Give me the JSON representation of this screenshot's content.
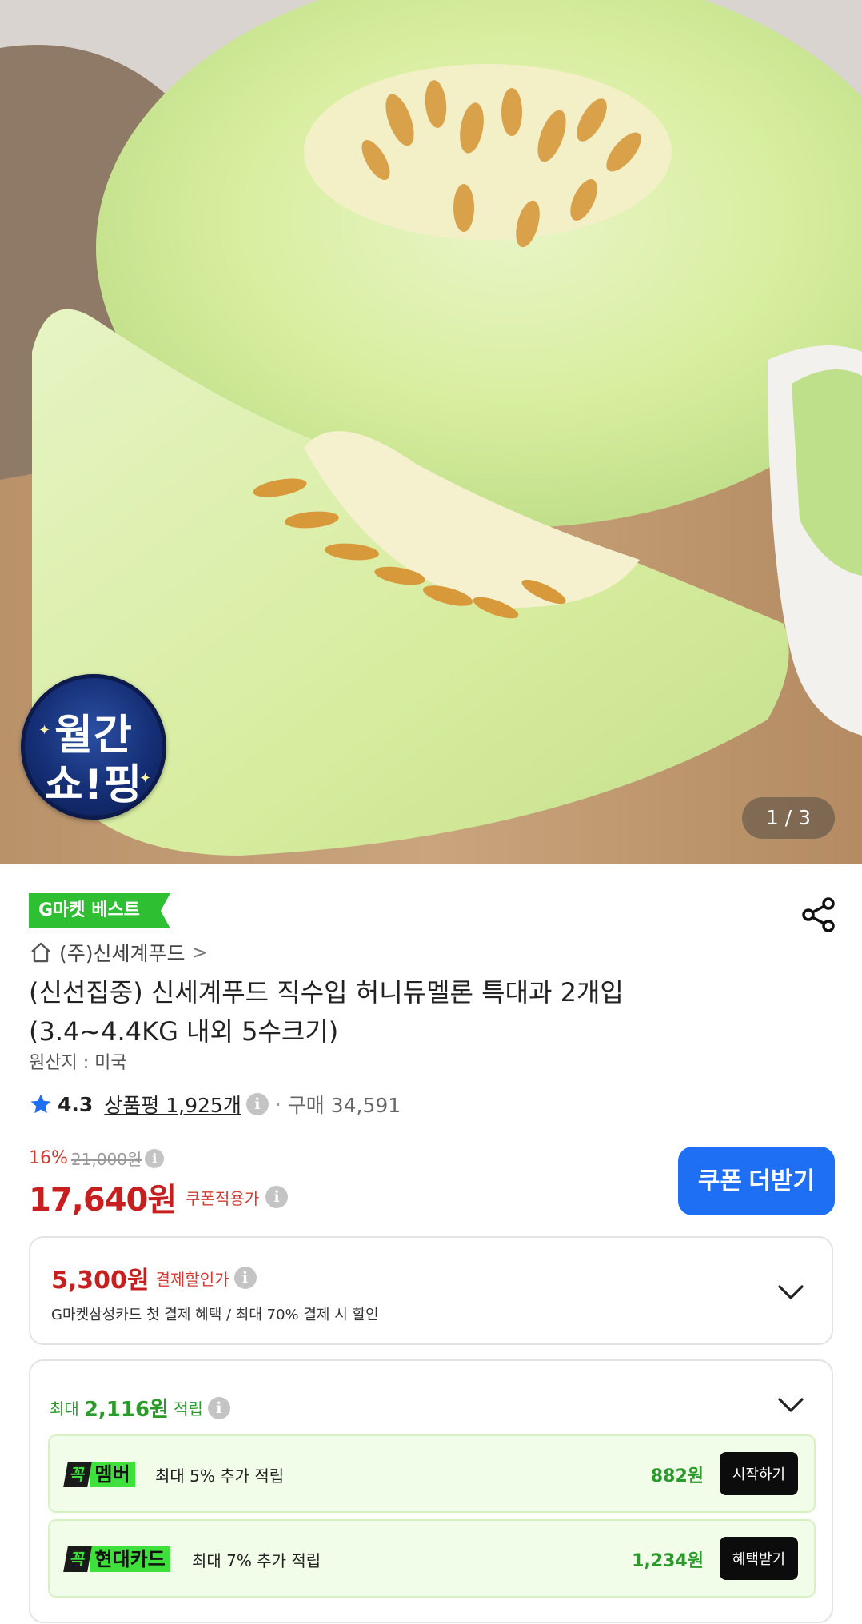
{
  "hero": {
    "badge_line1": "월간",
    "badge_line2": "쇼!핑",
    "page_indicator": "1 / 3"
  },
  "product": {
    "best_tag": "G마켓 베스트",
    "shop_name": "(주)신세계푸드",
    "shop_chevron": ">",
    "title_line1": "(신선집중) 신세계푸드 직수입 허니듀멜론 특대과 2개입",
    "title_line2": "(3.4~4.4KG 내외 5수크기)",
    "origin": "원산지 : 미국",
    "rating": "4.3",
    "reviews": "상품평 1,925개",
    "separator": "·",
    "purchases": "구매 34,591"
  },
  "price": {
    "discount_pct": "16%",
    "original_price": "21,000원",
    "final_price": "17,640원",
    "final_label": "쿠폰적용가",
    "coupon_button": "쿠폰 더받기"
  },
  "payment_discount": {
    "amount": "5,300원",
    "label": "결제할인가",
    "description": "G마켓삼성카드 첫 결제 혜택 / 최대 70% 결제 시 할인"
  },
  "rewards": {
    "prefix": "최대",
    "amount": "2,116원",
    "suffix": "적립",
    "items": [
      {
        "logo_k": "꼭",
        "logo_name": "멤버",
        "text": "최대 5% 추가 적립",
        "points": "882원",
        "action": "시작하기"
      },
      {
        "logo_k": "꼭",
        "logo_name": "현대카드",
        "text": "최대 7% 추가 적립",
        "points": "1,234원",
        "action": "혜택받기"
      }
    ]
  },
  "colors": {
    "accent_blue": "#1f6ff5",
    "price_red": "#c71f1f",
    "reward_green": "#2a9b2a",
    "best_green": "#2fbf33"
  },
  "icons": {
    "share": "share-icon",
    "home": "home-icon",
    "star": "star-icon",
    "info": "info-icon",
    "chevron_down": "chevron-down-icon"
  }
}
